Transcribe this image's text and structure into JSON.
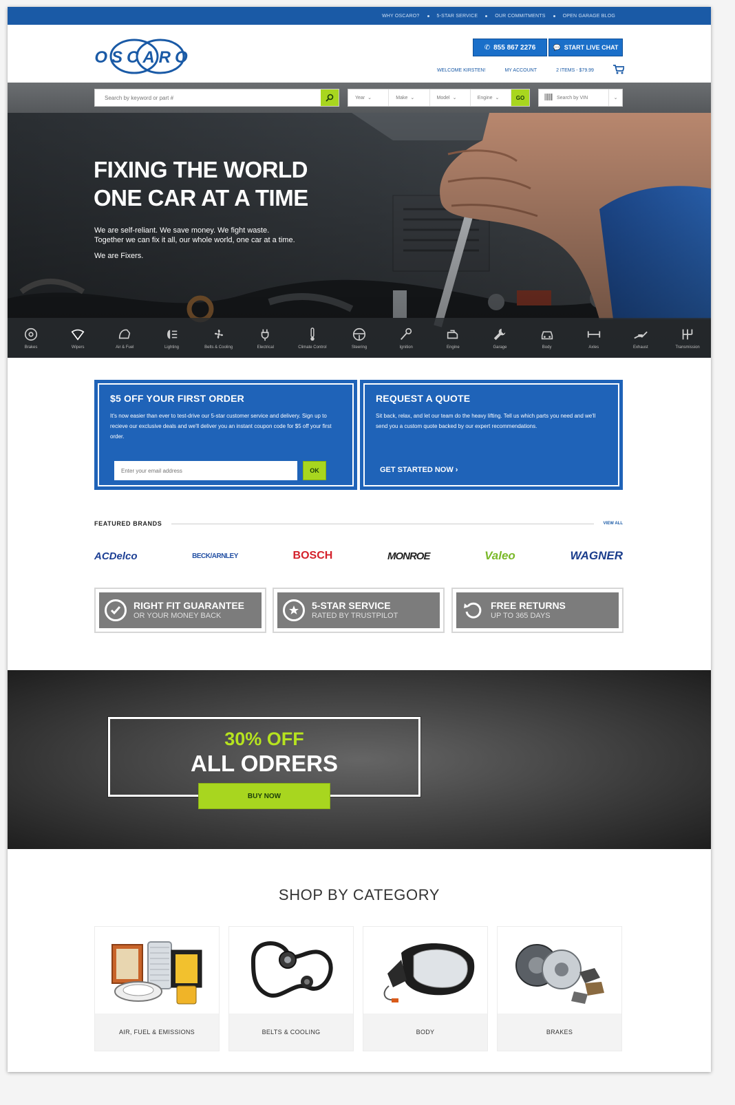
{
  "topbar": {
    "links": [
      "WHY OSCARO?",
      "5-STAR SERVICE",
      "OUR COMMITMENTS",
      "OPEN GARAGE BLOG"
    ]
  },
  "header": {
    "logo": "OSCARO",
    "phone": "855 867 2276",
    "chat": "START LIVE CHAT",
    "welcome": "WELCOME KIRSTEN!",
    "account": "MY ACCOUNT",
    "cart": "2 ITEMS - $79.99"
  },
  "search": {
    "placeholder": "Search by keyword or part #",
    "year": "Year",
    "make": "Make",
    "model": "Model",
    "engine": "Engine",
    "go": "GO",
    "vin": "Search by VIN"
  },
  "hero": {
    "title_line1": "FIXING THE WORLD",
    "title_line2": "ONE CAR AT A TIME",
    "text_line1": "We are self-reliant.  We save money.  We fight waste.",
    "text_line2": "Together we can fix it all, our whole world, one car at a time.",
    "text_line3": "We are Fixers."
  },
  "categories_bar": [
    {
      "label": "Brakes",
      "icon": "brake-icon"
    },
    {
      "label": "Wipers",
      "icon": "wiper-icon"
    },
    {
      "label": "Air & Fuel",
      "icon": "air-fuel-icon"
    },
    {
      "label": "Lighting",
      "icon": "headlight-icon"
    },
    {
      "label": "Belts & Cooling",
      "icon": "fan-icon"
    },
    {
      "label": "Electrical",
      "icon": "plug-icon"
    },
    {
      "label": "Climate Control",
      "icon": "thermometer-icon"
    },
    {
      "label": "Steering",
      "icon": "steering-wheel-icon"
    },
    {
      "label": "Ignition",
      "icon": "key-icon"
    },
    {
      "label": "Engine",
      "icon": "engine-icon"
    },
    {
      "label": "Garage",
      "icon": "wrench-icon"
    },
    {
      "label": "Body",
      "icon": "car-icon"
    },
    {
      "label": "Axles",
      "icon": "axle-icon"
    },
    {
      "label": "Exhaust",
      "icon": "exhaust-icon"
    },
    {
      "label": "Transmission",
      "icon": "gear-shift-icon"
    }
  ],
  "promo1": {
    "title": "$5 OFF YOUR FIRST ORDER",
    "text": "It's now easier than ever to test-drive our 5-star customer service and delivery. Sign up to recieve our exclusive deals and we'll deliver you an instant coupon code for $5 off your first order.",
    "email_placeholder": "Enter your email address",
    "ok": "OK"
  },
  "promo2": {
    "title": "REQUEST A QUOTE",
    "text": "Sit back, relax, and let our team do the heavy lifting. Tell us which parts you need and we'll send you a custom quote backed by our expert recommendations.",
    "cta": "GET STARTED NOW"
  },
  "brands": {
    "title": "FEATURED BRANDS",
    "view_all": "VIEW ALL",
    "items": [
      "ACDelco",
      "BECK/ARNLEY",
      "BOSCH",
      "MONROE",
      "Valeo",
      "WAGNER"
    ]
  },
  "guarantees": [
    {
      "title": "RIGHT FIT GUARANTEE",
      "sub": "OR YOUR MONEY BACK",
      "icon": "checkmark-icon"
    },
    {
      "title": "5-STAR SERVICE",
      "sub": "RATED BY TRUSTPILOT",
      "icon": "star-icon"
    },
    {
      "title": "FREE RETURNS",
      "sub": "UP TO 365 DAYS",
      "icon": "return-arrow-icon"
    }
  ],
  "sale": {
    "top": "30% OFF",
    "main": "ALL ODRERS",
    "button": "BUY NOW"
  },
  "shop": {
    "title": "SHOP BY CATEGORY",
    "items": [
      "AIR, FUEL & EMISSIONS",
      "BELTS & COOLING",
      "BODY",
      "BRAKES"
    ]
  },
  "colors": {
    "primary": "#1a5aa6",
    "accent": "#a8d61f",
    "topbar": "#1a5aa6"
  }
}
